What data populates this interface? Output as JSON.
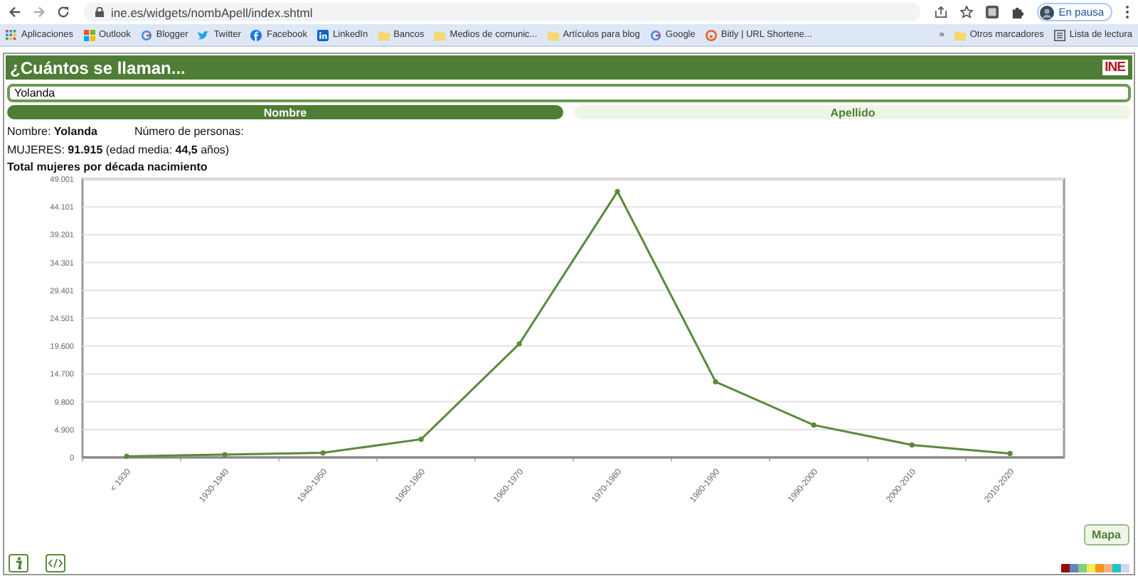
{
  "browser": {
    "url": "ine.es/widgets/nombApell/index.shtml",
    "profile": "En pausa",
    "bookmarks": [
      {
        "label": "Aplicaciones",
        "kind": "apps"
      },
      {
        "label": "Outlook",
        "kind": "tiles"
      },
      {
        "label": "Blogger",
        "kind": "g"
      },
      {
        "label": "Twitter",
        "kind": "bird"
      },
      {
        "label": "Facebook",
        "kind": "f"
      },
      {
        "label": "LinkedIn",
        "kind": "in"
      },
      {
        "label": "Bancos",
        "kind": "folder"
      },
      {
        "label": "Medios de comunic...",
        "kind": "folder"
      },
      {
        "label": "Artículos para blog",
        "kind": "folder"
      },
      {
        "label": "Google",
        "kind": "g"
      },
      {
        "label": "Bitly | URL Shortene...",
        "kind": "bitly"
      }
    ],
    "more": "»",
    "other_bookmarks": "Otros marcadores",
    "reading_list": "Lista de lectura"
  },
  "widget": {
    "title": "¿Cuántos se llaman...",
    "logo": "INE",
    "search": {
      "value": "Yolanda"
    },
    "tabs": [
      {
        "label": "Nombre",
        "selected": true
      },
      {
        "label": "Apellido",
        "selected": false
      }
    ],
    "name_line": "Nombre: **Yolanda**",
    "count_label": "Número de personas:",
    "stats": "MUJERES: **91.915** (edad media: **44,5** años)",
    "chart_title": "Total mujeres por década nacimiento",
    "chart_data": {
      "type": "line",
      "categories": [
        "< 1930",
        "1930-1940",
        "1940-1950",
        "1950-1960",
        "1960-1970",
        "1970-1980",
        "1980-1990",
        "1990-2000",
        "2000-2010",
        "2010-2020"
      ],
      "grid": true,
      "series": [
        {
          "color": "#5a8a3c",
          "marker": true,
          "values": [
            200,
            500,
            800,
            3200,
            20000,
            46800,
            13300,
            5700,
            2200,
            700
          ]
        }
      ],
      "ylim": [
        0,
        49001
      ],
      "yticks": [
        {
          "value": 0,
          "label": "0"
        },
        {
          "value": 4900,
          "label": "4.900"
        },
        {
          "value": 9800,
          "label": "9.800"
        },
        {
          "value": 14700,
          "label": "14.700"
        },
        {
          "value": 19600,
          "label": "19.600"
        },
        {
          "value": 24501,
          "label": "24.501"
        },
        {
          "value": 29401,
          "label": "29.401"
        },
        {
          "value": 34301,
          "label": "34.301"
        },
        {
          "value": 39201,
          "label": "39.201"
        },
        {
          "value": 44101,
          "label": "44.101"
        },
        {
          "value": 49001,
          "label": "49.001"
        }
      ]
    },
    "map_button": "Mapa",
    "color_swatches": [
      {
        "color": "#9b0a0a"
      },
      {
        "color": "#6a7fc0"
      },
      {
        "color": "#7fd17f"
      },
      {
        "color": "#f2ea5a"
      },
      {
        "color": "#f7941d"
      },
      {
        "color": "#f5b183"
      },
      {
        "color": "#22c3c9"
      },
      {
        "color": "#d6d6f2"
      }
    ]
  }
}
